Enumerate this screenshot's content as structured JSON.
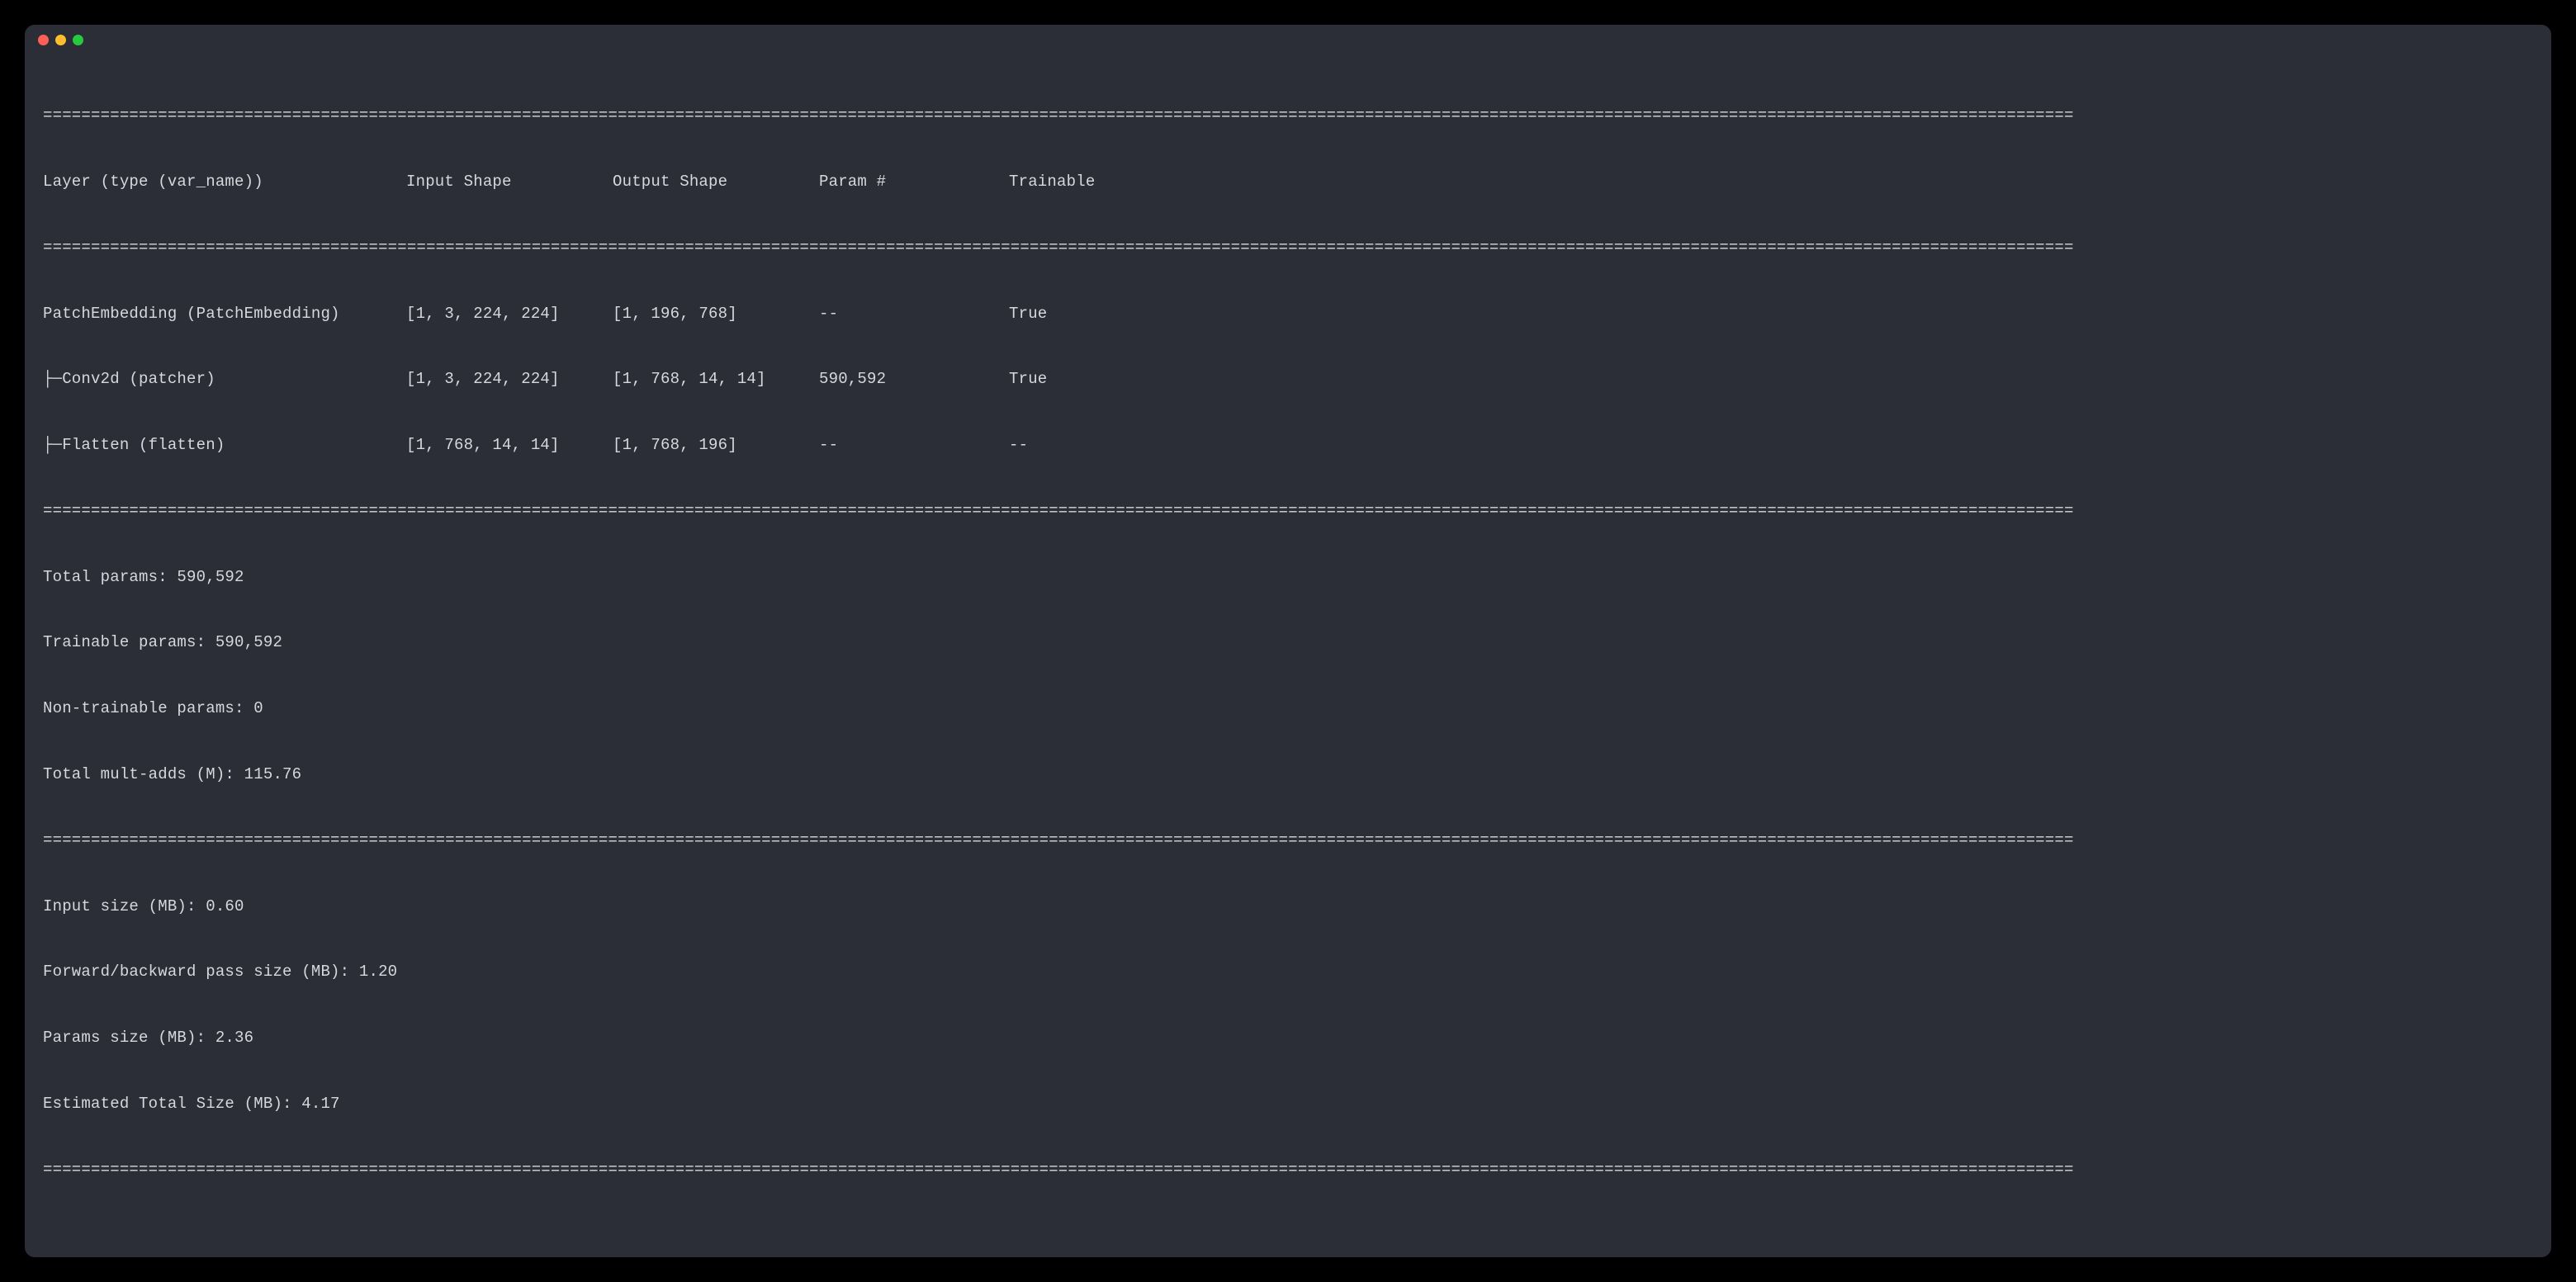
{
  "headers": {
    "layer": "Layer (type (var_name))",
    "input": "Input Shape",
    "output": "Output Shape",
    "param": "Param #",
    "trainable": "Trainable"
  },
  "rows": [
    {
      "layer": "PatchEmbedding (PatchEmbedding)",
      "input": "[1, 3, 224, 224]",
      "output": "[1, 196, 768]",
      "param": "--",
      "trainable": "True"
    },
    {
      "layer": "├─Conv2d (patcher)",
      "input": "[1, 3, 224, 224]",
      "output": "[1, 768, 14, 14]",
      "param": "590,592",
      "trainable": "True"
    },
    {
      "layer": "├─Flatten (flatten)",
      "input": "[1, 768, 14, 14]",
      "output": "[1, 768, 196]",
      "param": "--",
      "trainable": "--"
    }
  ],
  "stats1": {
    "total_params": "Total params: 590,592",
    "trainable_params": "Trainable params: 590,592",
    "non_trainable_params": "Non-trainable params: 0",
    "mult_adds": "Total mult-adds (M): 115.76"
  },
  "stats2": {
    "input_size": "Input size (MB): 0.60",
    "fwd_bwd": "Forward/backward pass size (MB): 1.20",
    "params_size": "Params size (MB): 2.36",
    "total_size": "Estimated Total Size (MB): 4.17"
  }
}
